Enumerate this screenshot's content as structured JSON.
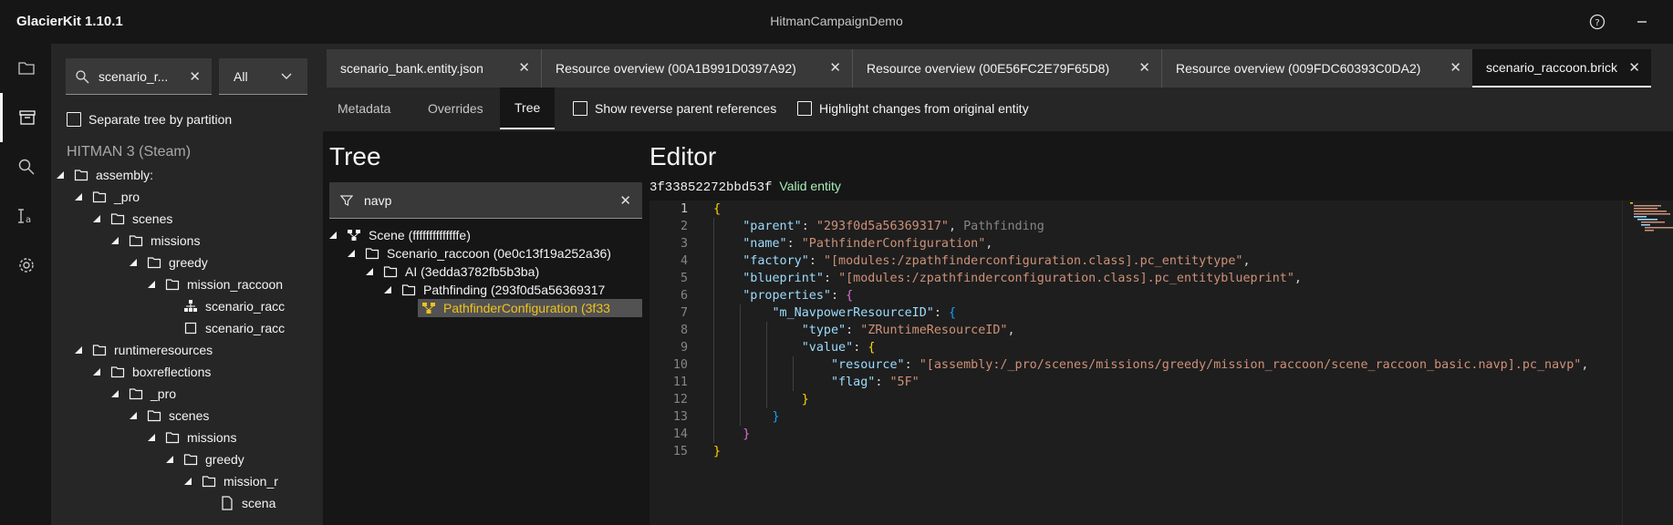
{
  "app": {
    "name": "GlacierKit 1.10.1",
    "window_title": "HitmanCampaignDemo"
  },
  "titlebar": {
    "help_icon": "help-circle-icon",
    "minimize_icon": "minimize-icon"
  },
  "rail": {
    "items": [
      {
        "name": "files-icon"
      },
      {
        "name": "archive-icon"
      },
      {
        "name": "search-icon"
      },
      {
        "name": "text-tools-icon"
      },
      {
        "name": "settings-icon"
      }
    ]
  },
  "sidebar": {
    "search_value": "scenario_r...",
    "filter_select": "All",
    "separate_label": "Separate tree by partition",
    "game_label": "HITMAN 3 (Steam)",
    "tree": [
      {
        "label": "assembly:",
        "icon": "folder"
      },
      {
        "label": "_pro",
        "icon": "folder"
      },
      {
        "label": "scenes",
        "icon": "folder"
      },
      {
        "label": "missions",
        "icon": "folder"
      },
      {
        "label": "greedy",
        "icon": "folder"
      },
      {
        "label": "mission_raccoon",
        "icon": "folder"
      },
      {
        "label": "scenario_racc",
        "icon": "entity"
      },
      {
        "label": "scenario_racc",
        "icon": "file"
      },
      {
        "label": "runtimeresources",
        "icon": "folder"
      },
      {
        "label": "boxreflections",
        "icon": "folder"
      },
      {
        "label": "_pro",
        "icon": "folder"
      },
      {
        "label": "scenes",
        "icon": "folder"
      },
      {
        "label": "missions",
        "icon": "folder"
      },
      {
        "label": "greedy",
        "icon": "folder"
      },
      {
        "label": "mission_r",
        "icon": "folder"
      },
      {
        "label": "scena",
        "icon": "doc"
      }
    ]
  },
  "tabs": [
    {
      "label": "scenario_bank.entity.json"
    },
    {
      "label": "Resource overview (00A1B991D0397A92)"
    },
    {
      "label": "Resource overview (00E56FC2E79F65D8)"
    },
    {
      "label": "Resource overview (009FDC60393C0DA2)"
    },
    {
      "label": "scenario_raccoon.brick"
    }
  ],
  "subtabs": [
    {
      "label": "Metadata"
    },
    {
      "label": "Overrides"
    },
    {
      "label": "Tree"
    }
  ],
  "options": {
    "reverse_refs": "Show reverse parent references",
    "highlight_changes": "Highlight changes from original entity"
  },
  "tree_panel": {
    "heading": "Tree",
    "filter_value": "navp",
    "nodes": [
      {
        "label": "Scene (ffffffffffffffe)"
      },
      {
        "label": "Scenario_raccoon (0e0c13f19a252a36)"
      },
      {
        "label": "AI (3edda3782fb5b3ba)"
      },
      {
        "label": "Pathfinding (293f0d5a56369317"
      },
      {
        "label": "PathfinderConfiguration (3f33"
      }
    ]
  },
  "editor": {
    "heading": "Editor",
    "entity_id": "3f33852272bbd53f",
    "status": "Valid entity",
    "lines": [
      "1",
      "2",
      "3",
      "4",
      "5",
      "6",
      "7",
      "8",
      "9",
      "10",
      "11",
      "12",
      "13",
      "14",
      "15"
    ],
    "code": {
      "parent_key": "\"parent\"",
      "parent_val": "\"293f0d5a56369317\"",
      "parent_hint": "Pathfinding",
      "name_key": "\"name\"",
      "name_val": "\"PathfinderConfiguration\"",
      "factory_key": "\"factory\"",
      "factory_val": "\"[modules:/zpathfinderconfiguration.class].pc_entitytype\"",
      "blueprint_key": "\"blueprint\"",
      "blueprint_val": "\"[modules:/zpathfinderconfiguration.class].pc_entityblueprint\"",
      "properties_key": "\"properties\"",
      "navpower_key": "\"m_NavpowerResourceID\"",
      "type_key": "\"type\"",
      "type_val": "\"ZRuntimeResourceID\"",
      "value_key": "\"value\"",
      "resource_key": "\"resource\"",
      "resource_val": "\"[assembly:/_pro/scenes/missions/greedy/mission_raccoon/scene_raccoon_basic.navp].pc_navp\"",
      "flag_key": "\"flag\"",
      "flag_val": "\"5F\""
    }
  }
}
